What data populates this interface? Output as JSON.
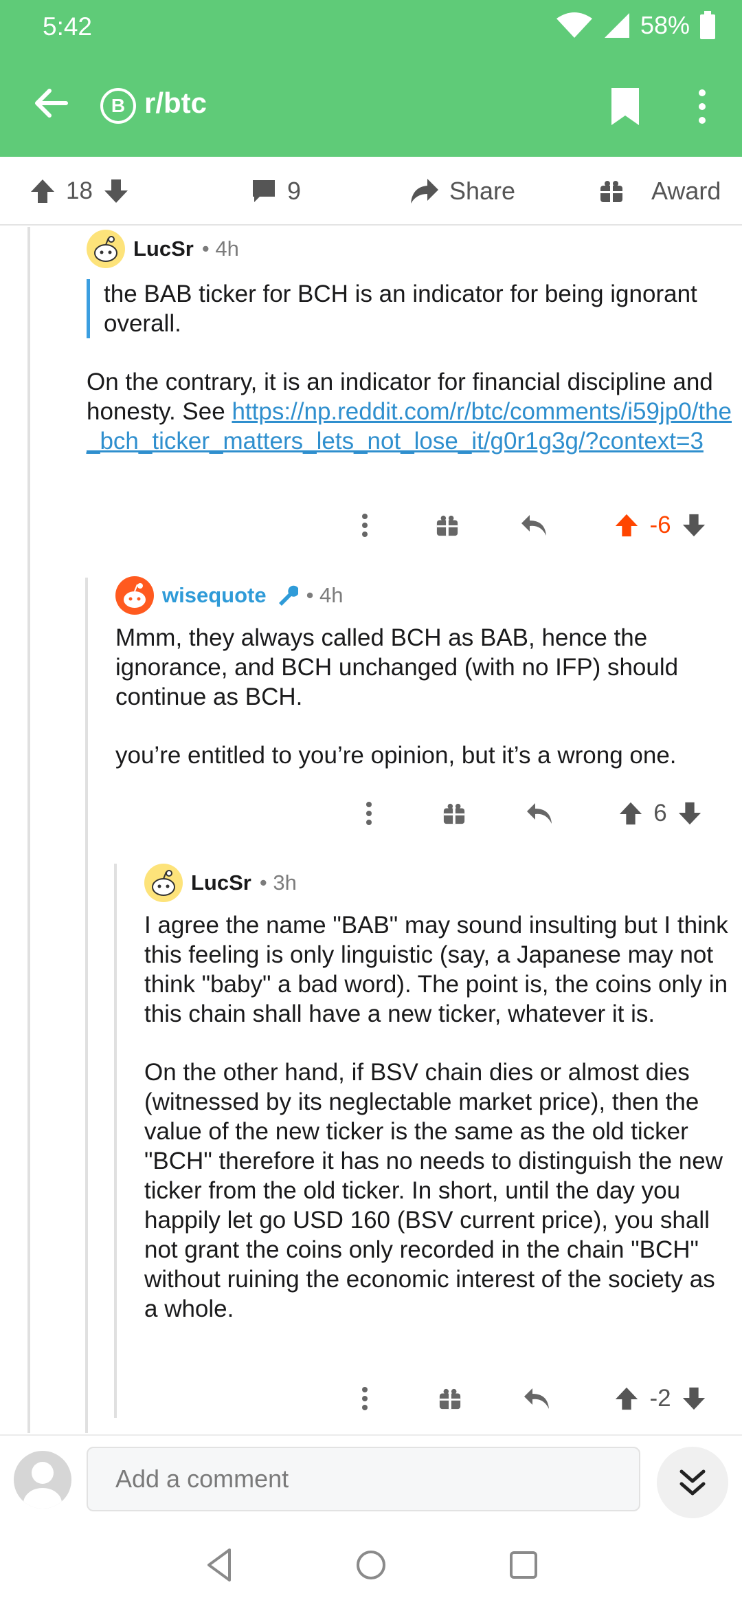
{
  "status": {
    "time": "5:42",
    "battery": "58%"
  },
  "appbar": {
    "subreddit": "r/btc",
    "badge_letter": "B"
  },
  "actionbar": {
    "upvotes": "18",
    "comments": "9",
    "share": "Share",
    "award": "Award"
  },
  "comments": [
    {
      "author": "LucSr",
      "time": "• 4h",
      "quote": "the BAB ticker for BCH is an indicator for being ignorant overall.",
      "body_text": "On the contrary, it is an indicator for financial discipline and honesty.  See ",
      "link": "https://np.reddit.com/r/btc/comments/i59jp0/the_bch_ticker_matters_lets_not_lose_it/g0r1g3g/?context=3",
      "score": "-6"
    },
    {
      "author": "wisequote",
      "time": "• 4h",
      "para1": "Mmm, they always called BCH as BAB, hence the ignorance, and BCH unchanged (with no IFP) should continue as BCH.",
      "para2": "you’re entitled to you’re opinion, but it’s a wrong one.",
      "score": "6"
    },
    {
      "author": "LucSr",
      "time": "• 3h",
      "para1": "I agree the name \"BAB\" may sound insulting but I think this feeling is only linguistic (say, a Japanese may not think \"baby\" a bad word).  The point is, the coins only in this chain shall have a new ticker, whatever it is.",
      "para2": "On the other hand, if BSV chain dies or almost dies (witnessed by its neglectable market price), then the value of the new ticker is the same as the old ticker \"BCH\" therefore it has no needs to distinguish the new ticker from the old ticker.  In short, until the day you happily let go USD 160 (BSV current price), you shall not grant the coins only recorded in the chain \"BCH\" without ruining the economic interest of the society as a whole.",
      "score": "-2"
    }
  ],
  "composer": {
    "placeholder": "Add a comment"
  },
  "colors": {
    "header": "#5fcb78",
    "upvote_active": "#ff4500",
    "link": "#2f8fce"
  }
}
